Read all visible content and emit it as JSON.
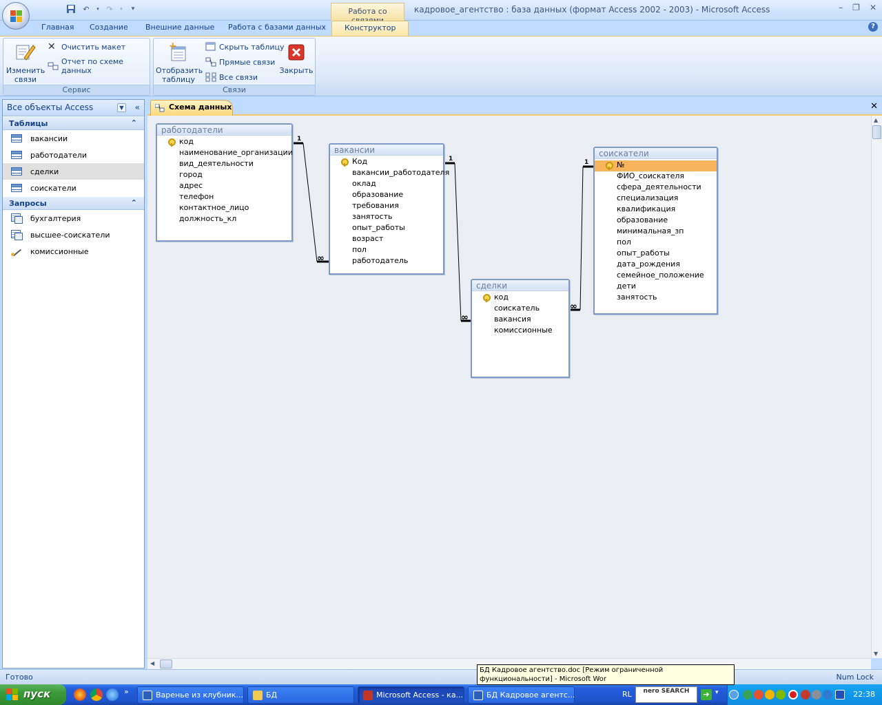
{
  "window": {
    "app_title": "кадровое_агентство : база данных (формат Access 2002 - 2003) - Microsoft Access",
    "context_tab_header": "Работа со связями"
  },
  "ribbon": {
    "tabs": [
      "Главная",
      "Создание",
      "Внешние данные",
      "Работа с базами данных",
      "Конструктор"
    ],
    "active_tab": "Конструктор",
    "groups": {
      "servis": {
        "label": "Сервис",
        "edit_links": "Изменить связи",
        "clear_layout": "Очистить макет",
        "report": "Отчет по схеме данных"
      },
      "svyazi": {
        "label": "Связи",
        "show_table": "Отобразить таблицу",
        "hide_table": "Скрыть таблицу",
        "direct_links": "Прямые связи",
        "all_links": "Все связи",
        "close": "Закрыть"
      }
    }
  },
  "nav": {
    "header": "Все объекты Access",
    "tables_label": "Таблицы",
    "tables": [
      "вакансии",
      "работодатели",
      "сделки",
      "соискатели"
    ],
    "selected_table": "сделки",
    "queries_label": "Запросы",
    "queries": [
      "бухгалтерия",
      "высшее-соискатели",
      "комиссионные"
    ]
  },
  "document": {
    "tab_label": "Схема данных"
  },
  "schema": {
    "tables": [
      {
        "id": "employers",
        "name": "работодатели",
        "key_field": "код",
        "fields": [
          "наименование_организации",
          "вид_деятельности",
          "город",
          "адрес",
          "телефон",
          "контактное_лицо",
          "должность_кл"
        ]
      },
      {
        "id": "vacancies",
        "name": "вакансии",
        "key_field": "Код",
        "fields": [
          "вакансии_работодателя",
          "оклад",
          "образование",
          "требования",
          "занятость",
          "опыт_работы",
          "возраст",
          "пол",
          "работодатель"
        ]
      },
      {
        "id": "deals",
        "name": "сделки",
        "key_field": "код",
        "fields": [
          "соискатель",
          "вакансия",
          "комиссионные"
        ]
      },
      {
        "id": "applicants",
        "name": "соискатели",
        "key_field": "№",
        "key_highlighted": true,
        "fields": [
          "ФИО_соискателя",
          "сфера_деятельности",
          "специализация",
          "квалификация",
          "образование",
          "минимальная_зп",
          "пол",
          "опыт_работы",
          "дата_рождения",
          "семейное_положение",
          "дети",
          "занятость"
        ]
      }
    ],
    "relations": [
      {
        "from": "работодатели",
        "to": "вакансии",
        "one": "1",
        "many": "∞"
      },
      {
        "from": "вакансии",
        "to": "сделки",
        "one": "1",
        "many": "∞"
      },
      {
        "from": "соискатели",
        "to": "сделки",
        "one": "1",
        "many": "∞"
      }
    ]
  },
  "status": {
    "left": "Готово",
    "right": "Num Lock",
    "tooltip": "БД Кадровое агентство.doc [Режим ограниченной функциональности] - Microsoft Wor"
  },
  "taskbar": {
    "start": "пуск",
    "tasks": [
      "Варенье из клубник...",
      "БД",
      "Microsoft Access - ка...",
      "БД Кадровое агентс..."
    ],
    "active_task": "Microsoft Access - ка...",
    "lang": "RL",
    "nero": "nero SEARCH",
    "clock": "22:38"
  }
}
